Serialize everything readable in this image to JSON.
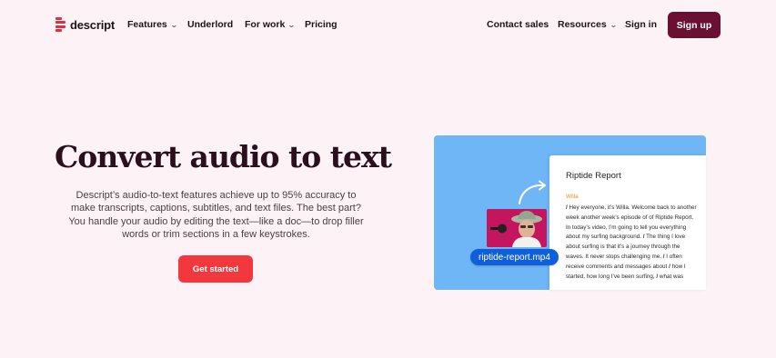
{
  "nav": {
    "logo_text": "descript",
    "items": [
      {
        "label": "Features",
        "has_dropdown": true
      },
      {
        "label": "Underlord",
        "has_dropdown": false
      },
      {
        "label": "For work",
        "has_dropdown": true
      },
      {
        "label": "Pricing",
        "has_dropdown": false
      }
    ],
    "right_items": [
      {
        "label": "Contact sales",
        "has_dropdown": false
      },
      {
        "label": "Resources",
        "has_dropdown": true
      },
      {
        "label": "Sign in",
        "has_dropdown": false
      }
    ],
    "signup_label": "Sign up"
  },
  "hero": {
    "title": "Convert audio to text",
    "description": "Descript’s audio-to-text features achieve up to 95% accuracy to make transcripts, captions, subtitles, and text files. The best part? You handle your audio by editing the text—like a doc—to drop filler words or trim sections in a few keystrokes.",
    "cta_label": "Get started"
  },
  "media": {
    "doc_title": "Riptide Report",
    "speaker": "Willa",
    "segments": [
      "Hey everyone, it’s Willa. Welcome back to another week another week’s episode of of Riptide Report. In today’s video, I’m going to tell you everything about my surfing background.",
      "The thing  I love about surfing is that it’s a  journey through the waves. It never stops challenging me.",
      "I often receive comments and messages about",
      "how I started, how long I’ve been surfing,",
      "what was"
    ],
    "file_name": "riptide-report.mp4"
  },
  "colors": {
    "page_bg": "#fdf3f6",
    "brand": "#6a1032",
    "cta": "#f2383e",
    "logo_accent": "#e0303e",
    "media_bg": "#6eb6f5",
    "file_pill": "#0f5fdb",
    "speaker": "#e0902a"
  },
  "icons": {
    "logo": "descript-logo-icon",
    "dropdown": "chevron-down-icon",
    "arrow": "curved-arrow-icon"
  }
}
